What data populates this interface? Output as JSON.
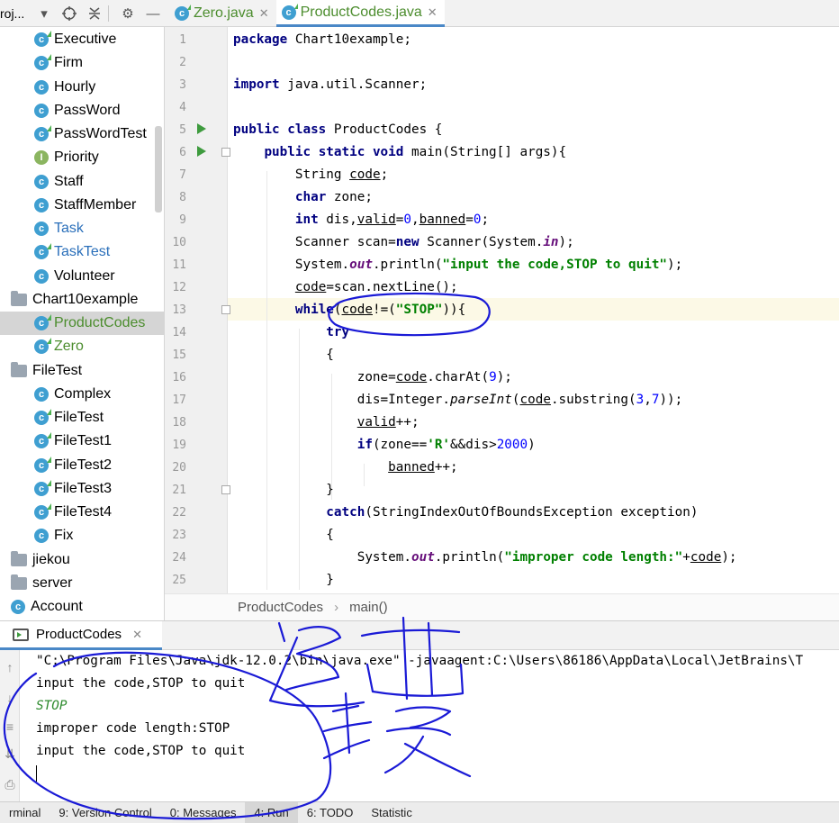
{
  "project_toolbar": {
    "project_label": "roj..."
  },
  "tabs": [
    {
      "label": "Zero.java",
      "active": false
    },
    {
      "label": "ProductCodes.java",
      "active": true
    }
  ],
  "tree": [
    {
      "label": "Executive",
      "icon": "class-runnable-icon"
    },
    {
      "label": "Firm",
      "icon": "class-runnable-icon"
    },
    {
      "label": "Hourly",
      "icon": "class-icon"
    },
    {
      "label": "PassWord",
      "icon": "class-icon"
    },
    {
      "label": "PassWordTest",
      "icon": "class-runnable-icon"
    },
    {
      "label": "Priority",
      "icon": "interface-icon"
    },
    {
      "label": "Staff",
      "icon": "class-icon"
    },
    {
      "label": "StaffMember",
      "icon": "class-icon"
    },
    {
      "label": "Task",
      "icon": "class-icon"
    },
    {
      "label": "TaskTest",
      "icon": "class-runnable-icon"
    },
    {
      "label": "Volunteer",
      "icon": "class-icon"
    },
    {
      "label": "Chart10example",
      "icon": "package-icon"
    },
    {
      "label": "ProductCodes",
      "icon": "class-runnable-icon",
      "selected": true
    },
    {
      "label": "Zero",
      "icon": "class-runnable-icon"
    },
    {
      "label": "FileTest",
      "icon": "package-icon"
    },
    {
      "label": "Complex",
      "icon": "class-icon"
    },
    {
      "label": "FileTest",
      "icon": "class-runnable-icon"
    },
    {
      "label": "FileTest1",
      "icon": "class-runnable-icon"
    },
    {
      "label": "FileTest2",
      "icon": "class-runnable-icon"
    },
    {
      "label": "FileTest3",
      "icon": "class-runnable-icon"
    },
    {
      "label": "FileTest4",
      "icon": "class-runnable-icon"
    },
    {
      "label": "Fix",
      "icon": "class-icon"
    },
    {
      "label": "jiekou",
      "icon": "package-icon"
    },
    {
      "label": "server",
      "icon": "package-icon"
    },
    {
      "label": "Account",
      "icon": "class-icon"
    }
  ],
  "editor": {
    "line_numbers": [
      "1",
      "2",
      "3",
      "4",
      "5",
      "6",
      "7",
      "8",
      "9",
      "10",
      "11",
      "12",
      "13",
      "14",
      "15",
      "16",
      "17",
      "18",
      "19",
      "20",
      "21",
      "22",
      "23",
      "24",
      "25"
    ],
    "current_line": "13"
  },
  "breadcrumb": {
    "class": "ProductCodes",
    "method": "main()"
  },
  "run_panel": {
    "tab_label": "ProductCodes",
    "console": {
      "command": "\"C:\\Program Files\\Java\\jdk-12.0.2\\bin\\java.exe\" -javaagent:C:\\Users\\86186\\AppData\\Local\\JetBrains\\T",
      "lines": [
        {
          "text": "input the code,STOP to quit",
          "kind": "output"
        },
        {
          "text": "STOP",
          "kind": "input"
        },
        {
          "text": "improper code length:STOP",
          "kind": "output"
        },
        {
          "text": "input the code,STOP to quit",
          "kind": "output"
        }
      ]
    }
  },
  "bottom_bar": [
    {
      "label": "rminal"
    },
    {
      "label": "9: Version Control"
    },
    {
      "label": "0: Messages"
    },
    {
      "label": "4: Run",
      "active": true
    },
    {
      "label": "6: TODO"
    },
    {
      "label": "Statistic"
    }
  ],
  "colors": {
    "keyword": "#000080",
    "string": "#008000",
    "number": "#0000ff",
    "accent": "#4a88c7",
    "annotation_ink": "#1a1ad6"
  }
}
